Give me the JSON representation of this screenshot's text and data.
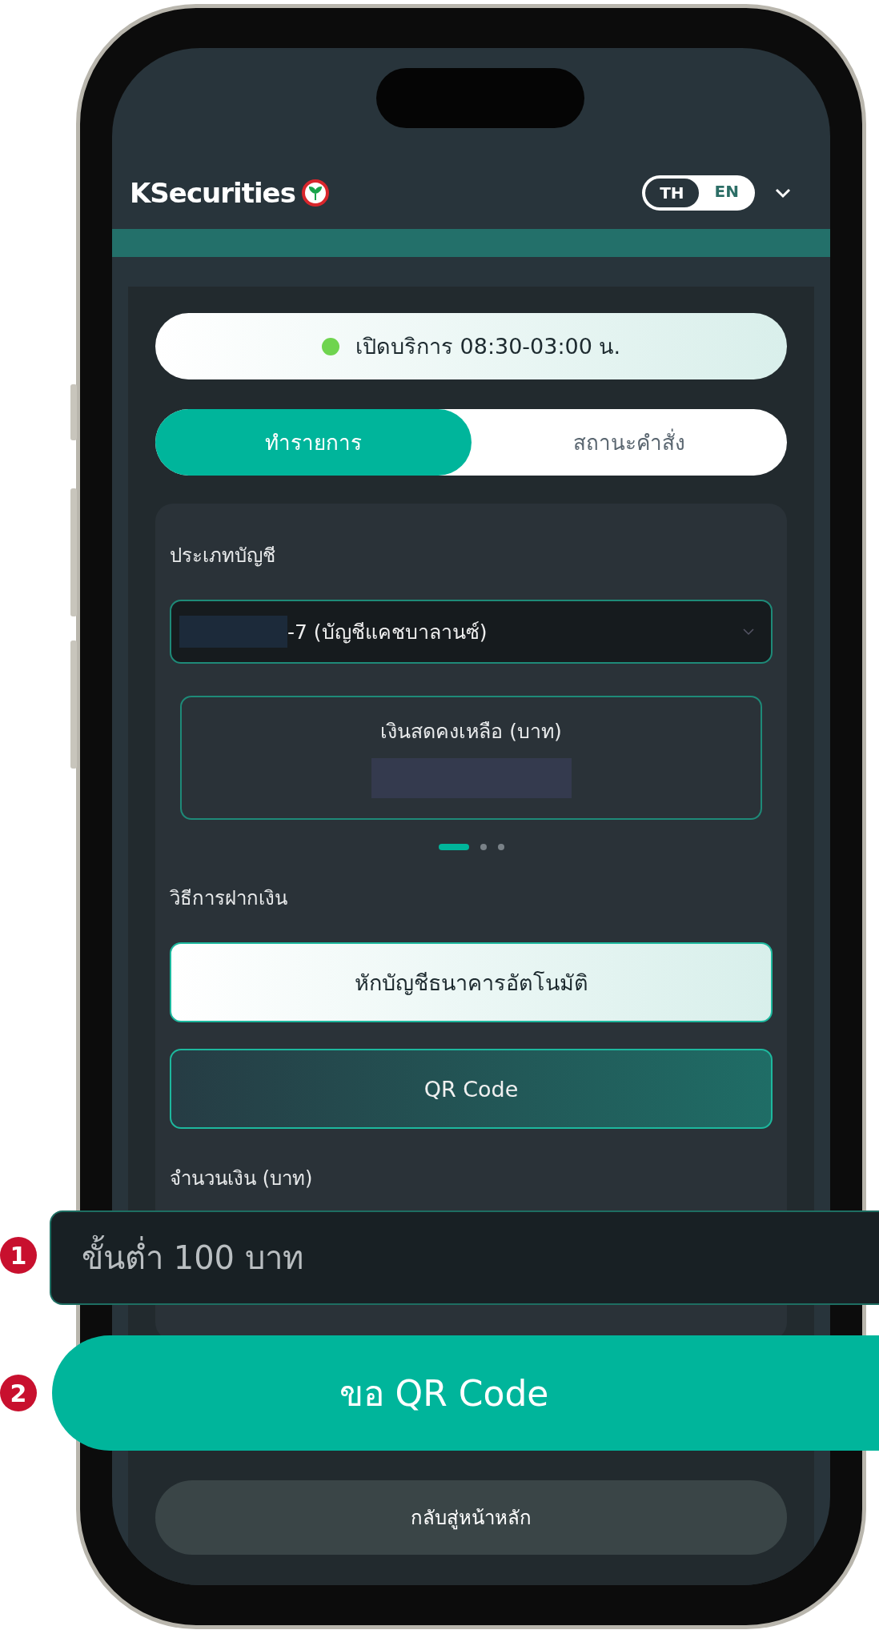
{
  "header": {
    "logo_text": "KSecurities",
    "language_toggle": [
      {
        "label": "TH",
        "selected": true
      },
      {
        "label": "EN",
        "selected": false
      }
    ]
  },
  "service_status": {
    "text": "เปิดบริการ 08:30-03:00 น."
  },
  "tabs": [
    {
      "label": "ทำรายการ",
      "selected": true
    },
    {
      "label": "สถานะคำสั่ง",
      "selected": false
    }
  ],
  "account": {
    "label": "ประเภทบัญชี",
    "value": "-7 (บัญชีแคชบาลานซ์)"
  },
  "balance_card": {
    "label": "เงินสดคงเหลือ (บาท)"
  },
  "carousel_dots": [
    {
      "selected": true
    },
    {
      "selected": false
    },
    {
      "selected": false
    }
  ],
  "deposit_method": {
    "label": "วิธีการฝากเงิน",
    "options": [
      {
        "label": "หักบัญชีธนาคารอัตโนมัติ",
        "selected": false
      },
      {
        "label": "QR Code",
        "selected": true
      }
    ]
  },
  "amount": {
    "label": "จำนวนเงิน (บาท)",
    "placeholder": "ขั้นต่ำ 100 บาท"
  },
  "request_button": "ขอ QR Code",
  "home_button": "กลับสู่หน้าหลัก",
  "callouts": [
    "1",
    "2"
  ]
}
